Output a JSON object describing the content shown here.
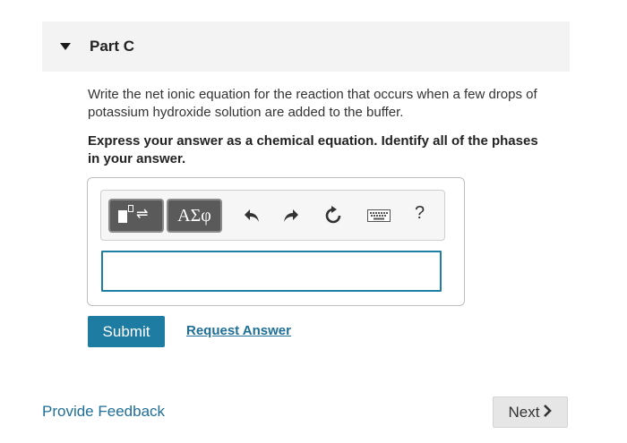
{
  "part": {
    "title": "Part C",
    "question": "Write the net ionic equation for the reaction that occurs when a few drops of potassium hydroxide solution are added to the buffer.",
    "instructions": "Express your answer as a chemical equation. Identify all of the phases in your answer."
  },
  "toolbar": {
    "template_icon": "template-reaction-icon",
    "greek_label": "ΑΣφ",
    "undo_icon": "undo-icon",
    "redo_icon": "redo-icon",
    "reset_icon": "reset-icon",
    "keyboard_icon": "keyboard-icon",
    "help_label": "?"
  },
  "answer": {
    "value": ""
  },
  "actions": {
    "submit_label": "Submit",
    "request_answer_label": "Request Answer"
  },
  "footer": {
    "feedback_label": "Provide Feedback",
    "next_label": "Next"
  },
  "colors": {
    "accent": "#1e7ba2",
    "link": "#1f6f96",
    "header_bg": "#f3f3f3"
  }
}
